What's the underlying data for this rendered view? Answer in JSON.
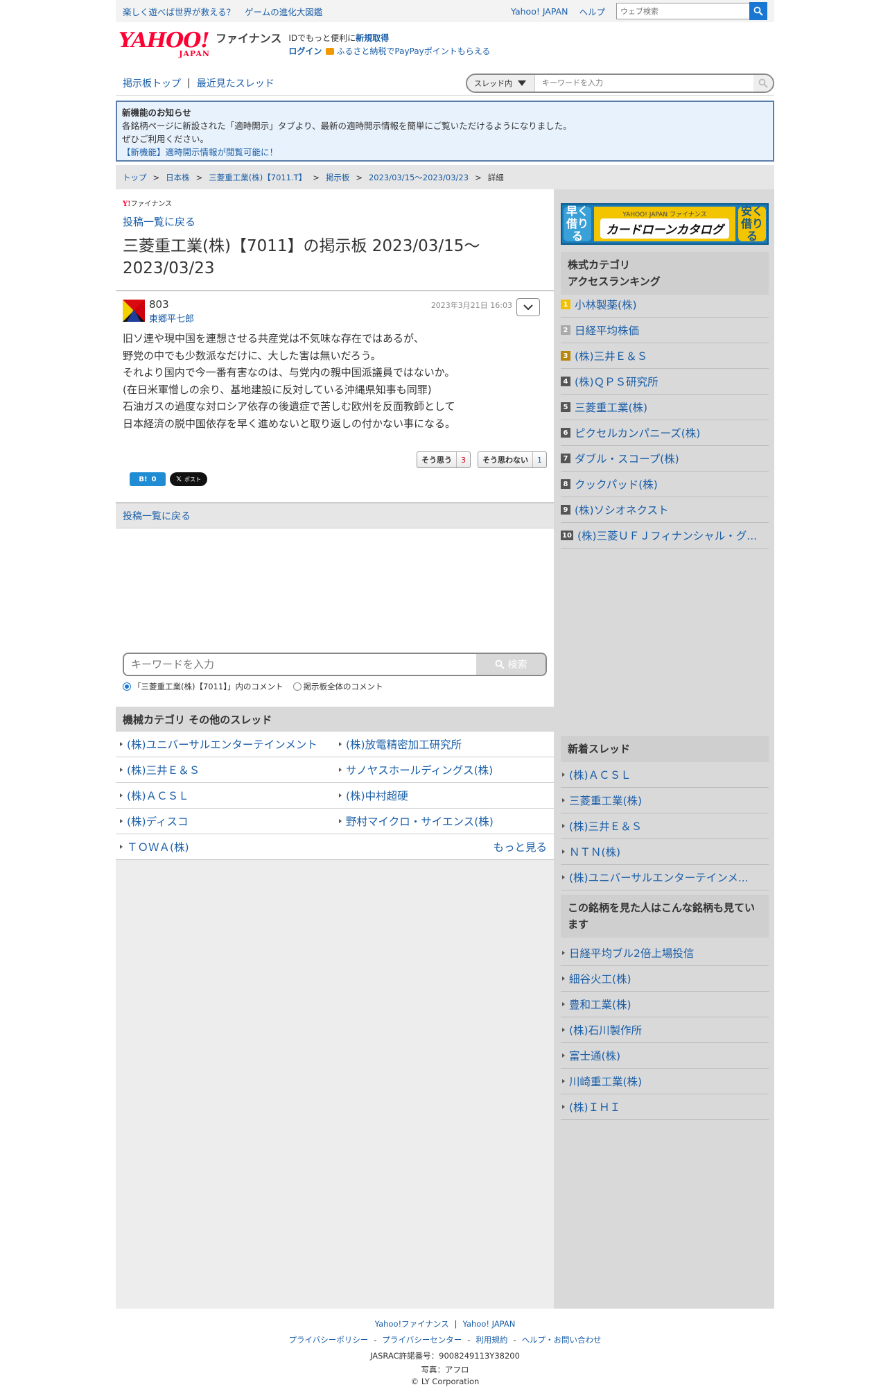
{
  "topbar": {
    "promo": [
      "楽しく遊べば世界が救える？",
      "ゲームの進化大図鑑"
    ],
    "links": [
      "Yahoo! JAPAN",
      "ヘルプ"
    ],
    "search_placeholder": "ウェブ検索"
  },
  "header": {
    "logo_yahoo": "YAHOO!",
    "logo_japan": "JAPAN",
    "logo_fin": "ファイナンス",
    "id_text": "IDでもっと便利に",
    "signup": "新規取得",
    "login": "ログイン",
    "furusato": "ふるさと納税でPayPayポイントもらえる"
  },
  "nav": {
    "items": [
      "掲示板トップ",
      "最近見たスレッド"
    ],
    "sep": "|",
    "scope": "スレッド内",
    "search_placeholder": "キーワードを入力"
  },
  "notice": {
    "title": "新機能のお知らせ",
    "line1": "各銘柄ページに新設された「適時開示」タブより、最新の適時開示情報を簡単にご覧いただけるようになりました。",
    "line2": "ぜひご利用ください。",
    "link": "【新機能】適時開示情報が閲覧可能に！"
  },
  "breadcrumb": {
    "items": [
      "トップ",
      "日本株",
      "三菱重工業(株)【7011.T】",
      "掲示板",
      "2023/03/15〜2023/03/23",
      "詳細"
    ],
    "sep": ">"
  },
  "main": {
    "mini_logo_y": "Y!",
    "mini_logo": "ファイナンス",
    "back_link": "投稿一覧に戻る",
    "title": "三菱重工業(株)【7011】の掲示板 2023/03/15〜2023/03/23"
  },
  "post": {
    "user_id": "803",
    "user_name": "東郷平七郎",
    "date": "2023年3月21日 16:03",
    "body": [
      "旧ソ連や現中国を連想させる共産党は不気味な存在ではあるが、",
      "野党の中でも少数派なだけに、大した害は無いだろう。",
      "それより国内で今一番有害なのは、与党内の親中国派議員ではないか。",
      "(在日米軍憎しの余り、基地建設に反対している沖縄県知事も同罪)",
      "石油ガスの過度な対ロシア依存の後遺症で苦しむ欧州を反面教師として",
      "日本経済の脱中国依存を早く進めないと取り返しの付かない事になる。"
    ],
    "agree_label": "そう思う",
    "agree_count": "3",
    "disagree_label": "そう思わない",
    "disagree_count": "1",
    "hatena_label": "B!",
    "hatena_count": "0",
    "x_label": "ポスト"
  },
  "back_bar": "投稿一覧に戻る",
  "keyword_search": {
    "placeholder": "キーワードを入力",
    "button": "検索",
    "radio_thread": "「三菱重工業(株)【7011】」内のコメント",
    "radio_all": "掲示板全体のコメント"
  },
  "category": {
    "title": "機械カテゴリ その他のスレッド",
    "rows": [
      [
        "(株)ユニバーサルエンターテインメント",
        "(株)放電精密加工研究所"
      ],
      [
        "(株)三井Ｅ＆Ｓ",
        "サノヤスホールディングス(株)"
      ],
      [
        "(株)ＡＣＳＬ",
        "(株)中村超硬"
      ],
      [
        "(株)ディスコ",
        "野村マイクロ・サイエンス(株)"
      ]
    ],
    "last": "ＴＯＷＡ(株)",
    "more": "もっと見る"
  },
  "sidebar": {
    "ad": {
      "left": "早く借りる",
      "brand": "YAHOO! JAPAN ファイナンス",
      "title": "カードローンカタログ",
      "right": "安く借りる"
    },
    "ranking_title": "株式カテゴリ\nアクセスランキング",
    "ranking_title_1": "株式カテゴリ",
    "ranking_title_2": "アクセスランキング",
    "ranking": [
      {
        "rank": "1",
        "name": "小林製薬(株)"
      },
      {
        "rank": "2",
        "name": "日経平均株価"
      },
      {
        "rank": "3",
        "name": "(株)三井Ｅ＆Ｓ"
      },
      {
        "rank": "4",
        "name": "(株)ＱＰＳ研究所"
      },
      {
        "rank": "5",
        "name": "三菱重工業(株)"
      },
      {
        "rank": "6",
        "name": "ピクセルカンパニーズ(株)"
      },
      {
        "rank": "7",
        "name": "ダブル・スコープ(株)"
      },
      {
        "rank": "8",
        "name": "クックパッド(株)"
      },
      {
        "rank": "9",
        "name": "(株)ソシオネクスト"
      },
      {
        "rank": "10",
        "name": "(株)三菱ＵＦＪフィナンシャル・グ..."
      }
    ],
    "new_title": "新着スレッド",
    "new_threads": [
      "(株)ＡＣＳＬ",
      "三菱重工業(株)",
      "(株)三井Ｅ＆Ｓ",
      "ＮＴＮ(株)",
      "(株)ユニバーサルエンターテインメ..."
    ],
    "also_title": "この銘柄を見た人はこんな銘柄も見ています",
    "also": [
      "日経平均ブル2倍上場投信",
      "細谷火工(株)",
      "豊和工業(株)",
      "(株)石川製作所",
      "富士通(株)",
      "川崎重工業(株)",
      "(株)ＩＨＩ"
    ]
  },
  "footer": {
    "row1": [
      "Yahoo!ファイナンス",
      "Yahoo! JAPAN"
    ],
    "row2": [
      "プライバシーポリシー",
      "プライバシーセンター",
      "利用規約",
      "ヘルプ・お問い合わせ"
    ],
    "jasrac": "JASRAC許諾番号：9008249113Y38200",
    "photo": "写真：アフロ",
    "copyright": "© LY Corporation"
  }
}
